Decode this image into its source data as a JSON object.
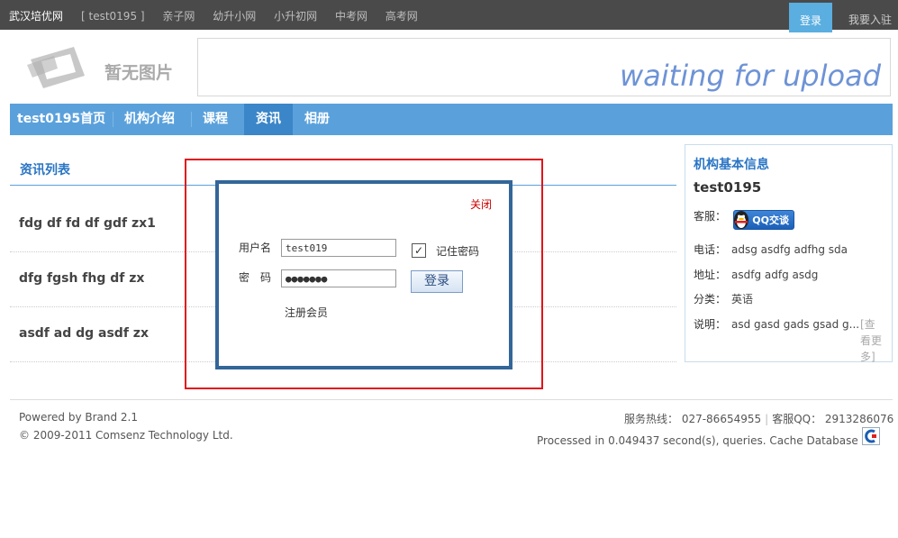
{
  "topbar": {
    "brand": "武汉培优网",
    "current": "[ test0195 ]",
    "links": [
      "亲子网",
      "幼升小网",
      "小升初网",
      "中考网",
      "高考网"
    ],
    "login": "登录",
    "join": "我要入驻"
  },
  "logo": {
    "text": "暂无图片"
  },
  "banner": {
    "text": "waiting for upload"
  },
  "nav": {
    "items": [
      "test0195首页",
      "机构介绍",
      "课程",
      "资讯",
      "相册"
    ],
    "active": "资讯"
  },
  "list": {
    "title": "资讯列表",
    "items": [
      "fdg df fd df gdf zx1",
      "dfg fgsh fhg df zx",
      "asdf ad dg asdf zx"
    ]
  },
  "sidebar": {
    "title": "机构基本信息",
    "name": "test0195",
    "kefu_label": "客服：",
    "qq_button": "QQ交谈",
    "phone_label": "电话：",
    "phone": "adsg asdfg adfhg sda",
    "address_label": "地址：",
    "address": "asdfg adfg asdg",
    "category_label": "分类：",
    "category": "英语",
    "desc_label": "说明：",
    "desc": "asd gasd gads gsad g...",
    "more": "[查看更多]"
  },
  "modal": {
    "close": "关闭",
    "username_label": "用户名",
    "username_value": "test019",
    "password_label": "密　码",
    "password_value": "●●●●●●●",
    "remember_label": "记住密码",
    "login_button": "登录",
    "register": "注册会员"
  },
  "footer": {
    "powered": "Powered by Brand 2.1",
    "copyright": "© 2009-2011 Comsenz Technology Ltd.",
    "hotline": "服务热线： 027-86654955",
    "qq": "客服QQ： 2913286076",
    "processed": "Processed in 0.049437 second(s), queries. Cache Database On."
  }
}
